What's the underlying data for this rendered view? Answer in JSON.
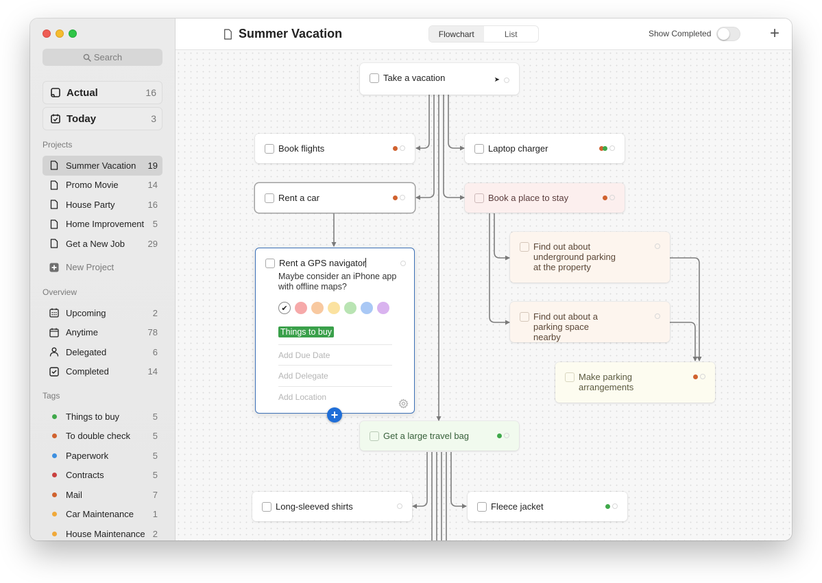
{
  "window": {
    "title": "Summer Vacation"
  },
  "sidebar": {
    "search_placeholder": "Search",
    "pinned": [
      {
        "label": "Actual",
        "count": "16",
        "icon": "tray-icon"
      },
      {
        "label": "Today",
        "count": "3",
        "icon": "calendar-check-icon"
      }
    ],
    "projects_label": "Projects",
    "projects": [
      {
        "label": "Summer Vacation",
        "count": "19",
        "selected": true
      },
      {
        "label": "Promo Movie",
        "count": "14"
      },
      {
        "label": "House Party",
        "count": "16"
      },
      {
        "label": "Home Improvement",
        "count": "5"
      },
      {
        "label": "Get a New Job",
        "count": "29"
      }
    ],
    "new_project_label": "New Project",
    "overview_label": "Overview",
    "overview": [
      {
        "label": "Upcoming",
        "count": "2",
        "icon": "calendar-grid-icon"
      },
      {
        "label": "Anytime",
        "count": "78",
        "icon": "calendar-icon"
      },
      {
        "label": "Delegated",
        "count": "6",
        "icon": "person-icon"
      },
      {
        "label": "Completed",
        "count": "14",
        "icon": "checked-box-icon"
      }
    ],
    "tags_label": "Tags",
    "tags": [
      {
        "label": "Things to buy",
        "count": "5",
        "color": "#3fa84a"
      },
      {
        "label": "To double check",
        "count": "5",
        "color": "#d0622f"
      },
      {
        "label": "Paperwork",
        "count": "5",
        "color": "#3d8fe0"
      },
      {
        "label": "Contracts",
        "count": "5",
        "color": "#c9403f"
      },
      {
        "label": "Mail",
        "count": "7",
        "color": "#d0622f"
      },
      {
        "label": "Car Maintenance",
        "count": "1",
        "color": "#f0a93a"
      },
      {
        "label": "House Maintenance",
        "count": "2",
        "color": "#f0a93a"
      }
    ]
  },
  "header": {
    "title": "Summer Vacation",
    "view_tabs": [
      {
        "label": "Flowchart",
        "active": true
      },
      {
        "label": "List",
        "active": false
      }
    ],
    "show_completed_label": "Show Completed",
    "show_completed": false,
    "add_label": "+"
  },
  "flowchart": {
    "tasks": {
      "take_vacation": {
        "label": "Take a vacation",
        "markers": [
          "location",
          "empty"
        ]
      },
      "book_flights": {
        "label": "Book flights",
        "markers": [
          "#d0622f",
          "empty"
        ]
      },
      "laptop_charger": {
        "label": "Laptop charger",
        "markers": [
          "#d0622f",
          "#3fa84a",
          "empty"
        ]
      },
      "rent_car": {
        "label": "Rent a car",
        "markers": [
          "#d0622f",
          "empty"
        ]
      },
      "book_place": {
        "label": "Book a place to stay",
        "markers": [
          "#d0622f",
          "empty"
        ]
      },
      "underground_parking": {
        "label": "Find out about underground parking at the property",
        "markers": [
          "empty"
        ]
      },
      "parking_nearby": {
        "label": "Find out about a parking space nearby",
        "markers": [
          "empty"
        ]
      },
      "make_parking": {
        "label": "Make parking arrangements",
        "markers": [
          "#d0622f",
          "empty"
        ]
      },
      "travel_bag": {
        "label": "Get a large travel bag",
        "markers": [
          "#3fa84a",
          "empty"
        ]
      },
      "long_sleeved": {
        "label": "Long-sleeved shirts",
        "markers": [
          "empty"
        ]
      },
      "fleece": {
        "label": "Fleece jacket",
        "markers": [
          "#3fa84a",
          "empty"
        ]
      }
    },
    "editor": {
      "title": "Rent a GPS navigator",
      "note": "Maybe consider an iPhone app with offline maps?",
      "colors": [
        "none",
        "#f6a9a9",
        "#f8c9a0",
        "#fbe2a0",
        "#b9e4b3",
        "#a9c8f5",
        "#d9b3ef"
      ],
      "selected_color": "none",
      "tag": "Things to buy",
      "due_date_placeholder": "Add Due Date",
      "delegate_placeholder": "Add Delegate",
      "location_placeholder": "Add Location"
    }
  }
}
